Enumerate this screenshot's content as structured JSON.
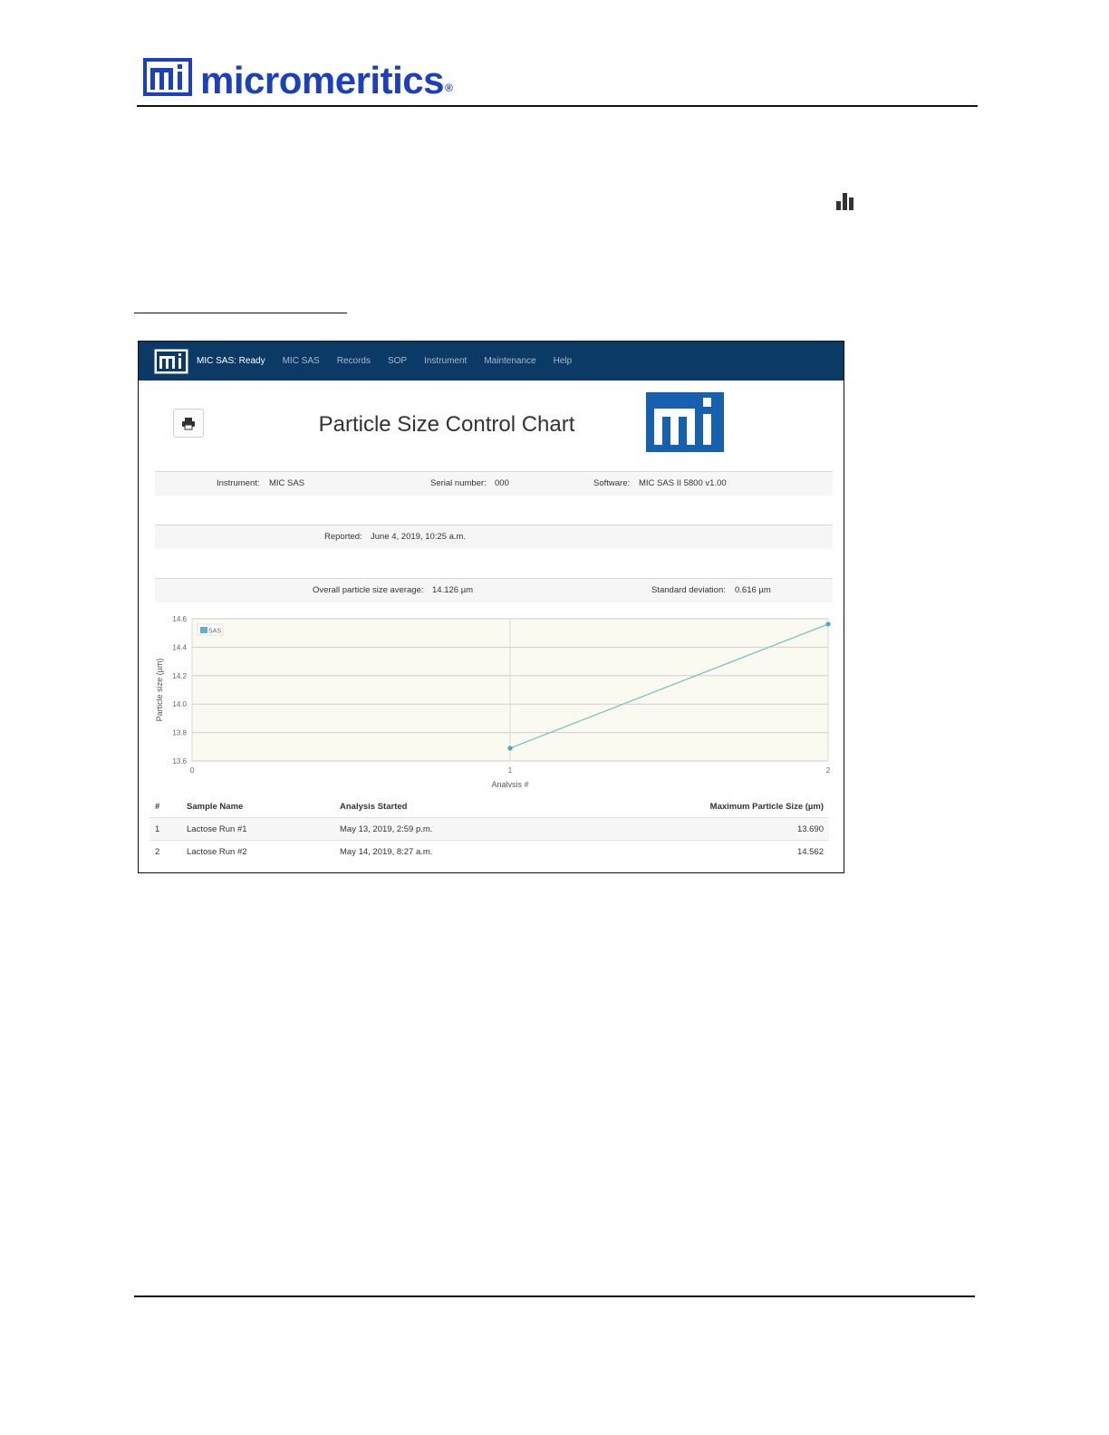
{
  "brand": {
    "name": "micromeritics",
    "mark": "mi",
    "registered": "®"
  },
  "icons": {
    "report_icon": "bar-chart-icon",
    "print_icon": "printer-icon"
  },
  "navbar": {
    "status": "MIC SAS: Ready",
    "items": [
      "MIC SAS",
      "Records",
      "SOP",
      "Instrument",
      "Maintenance",
      "Help"
    ]
  },
  "report": {
    "title": "Particle Size Control Chart",
    "instrument_label": "Instrument:",
    "instrument": "MIC SAS",
    "serial_label": "Serial number:",
    "serial": "000",
    "software_label": "Software:",
    "software": "MIC SAS II 5800 v1.00",
    "reported_label": "Reported:",
    "reported": "June 4, 2019, 10:25 a.m.",
    "average_label": "Overall particle size average:",
    "average": "14.126 µm",
    "stddev_label": "Standard deviation:",
    "stddev": "0.616 µm"
  },
  "colors": {
    "brand_blue": "#1a3fbf",
    "navbar": "#0b3a66",
    "series": "#7cc3c4",
    "plot_bg": "#fbfaf0"
  },
  "chart_data": {
    "type": "line",
    "xlabel": "Analysis #",
    "ylabel": "Particle size (µm)",
    "xlim": [
      0,
      2
    ],
    "ylim": [
      13.6,
      14.6
    ],
    "x_ticks": [
      "0",
      "1",
      "2"
    ],
    "y_ticks": [
      "14.6",
      "14.4",
      "14.2",
      "14.0",
      "13.8",
      "13.6"
    ],
    "grid": true,
    "legend_position": "top-left",
    "series": [
      {
        "name": "SAS",
        "x": [
          1,
          2
        ],
        "y": [
          13.69,
          14.562
        ]
      }
    ]
  },
  "table": {
    "headers": [
      "#",
      "Sample Name",
      "Analysis Started",
      "Maximum Particle Size (µm)"
    ],
    "rows": [
      [
        "1",
        "Lactose Run #1",
        "May 13, 2019, 2:59 p.m.",
        "13.690"
      ],
      [
        "2",
        "Lactose Run #2",
        "May 14, 2019, 8:27 a.m.",
        "14.562"
      ]
    ]
  }
}
